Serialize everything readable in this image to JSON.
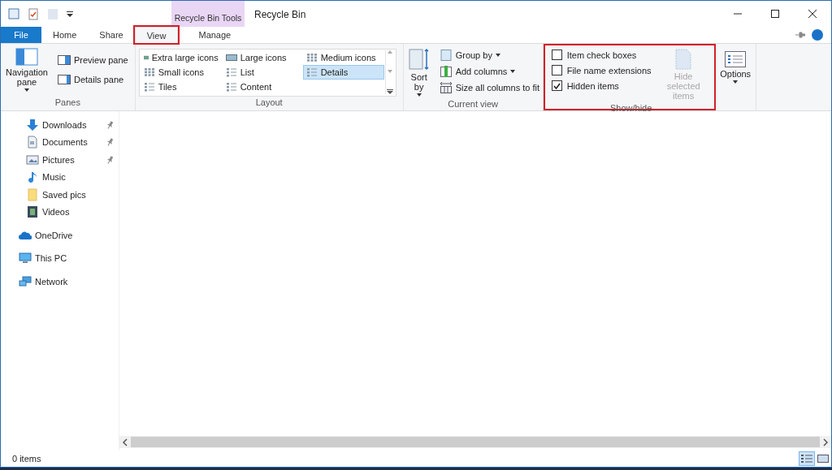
{
  "window": {
    "title": "Recycle Bin",
    "contextual_tab": "Recycle Bin Tools"
  },
  "tabs": [
    {
      "label": "File",
      "kind": "file",
      "selected": false,
      "highlighted": false
    },
    {
      "label": "Home",
      "kind": "tab",
      "selected": false,
      "highlighted": false
    },
    {
      "label": "Share",
      "kind": "tab",
      "selected": false,
      "highlighted": false
    },
    {
      "label": "View",
      "kind": "tab",
      "selected": true,
      "highlighted": true
    },
    {
      "label": "Manage",
      "kind": "contextual",
      "selected": false,
      "highlighted": false
    }
  ],
  "panes_group": {
    "label": "Panes",
    "navigation_pane": "Navigation pane",
    "items": [
      {
        "label": "Preview pane",
        "kind": "preview"
      },
      {
        "label": "Details pane",
        "kind": "details"
      }
    ]
  },
  "layout_group": {
    "label": "Layout",
    "items": [
      {
        "label": "Extra large icons",
        "kind": "xl",
        "selected": false
      },
      {
        "label": "Large icons",
        "kind": "large",
        "selected": false
      },
      {
        "label": "Medium icons",
        "kind": "medium",
        "selected": false
      },
      {
        "label": "Small icons",
        "kind": "small",
        "selected": false
      },
      {
        "label": "List",
        "kind": "list",
        "selected": false
      },
      {
        "label": "Details",
        "kind": "details",
        "selected": true
      },
      {
        "label": "Tiles",
        "kind": "tiles",
        "selected": false
      },
      {
        "label": "Content",
        "kind": "content",
        "selected": false
      }
    ]
  },
  "current_view_group": {
    "label": "Current view",
    "sort_by": "Sort by",
    "items": [
      {
        "label": "Group by",
        "kind": "group",
        "dropdown": true
      },
      {
        "label": "Add columns",
        "kind": "columns",
        "dropdown": true
      },
      {
        "label": "Size all columns to fit",
        "kind": "fit",
        "dropdown": false
      }
    ]
  },
  "show_hide_group": {
    "label": "Show/hide",
    "highlighted": true,
    "checkboxes": [
      {
        "label": "Item check boxes",
        "checked": false
      },
      {
        "label": "File name extensions",
        "checked": false
      },
      {
        "label": "Hidden items",
        "checked": true
      }
    ],
    "hide_selected": {
      "label": "Hide selected items",
      "disabled": true
    }
  },
  "options": {
    "label": "Options"
  },
  "nav_pane": {
    "sections": [
      {
        "items": [
          {
            "label": "Downloads",
            "kind": "downloads",
            "pinned": true
          },
          {
            "label": "Documents",
            "kind": "documents",
            "pinned": true
          },
          {
            "label": "Pictures",
            "kind": "pictures",
            "pinned": true
          },
          {
            "label": "Music",
            "kind": "music",
            "pinned": false
          },
          {
            "label": "Saved pics",
            "kind": "folder",
            "pinned": false
          },
          {
            "label": "Videos",
            "kind": "videos",
            "pinned": false
          }
        ]
      },
      {
        "items": [
          {
            "label": "OneDrive",
            "kind": "onedrive",
            "pinned": false
          }
        ]
      },
      {
        "items": [
          {
            "label": "This PC",
            "kind": "pc",
            "pinned": false
          }
        ]
      },
      {
        "items": [
          {
            "label": "Network",
            "kind": "network",
            "pinned": false
          }
        ]
      }
    ]
  },
  "status_bar": {
    "count": "0 items",
    "views": [
      {
        "kind": "details",
        "selected": true
      },
      {
        "kind": "large",
        "selected": false
      }
    ]
  }
}
